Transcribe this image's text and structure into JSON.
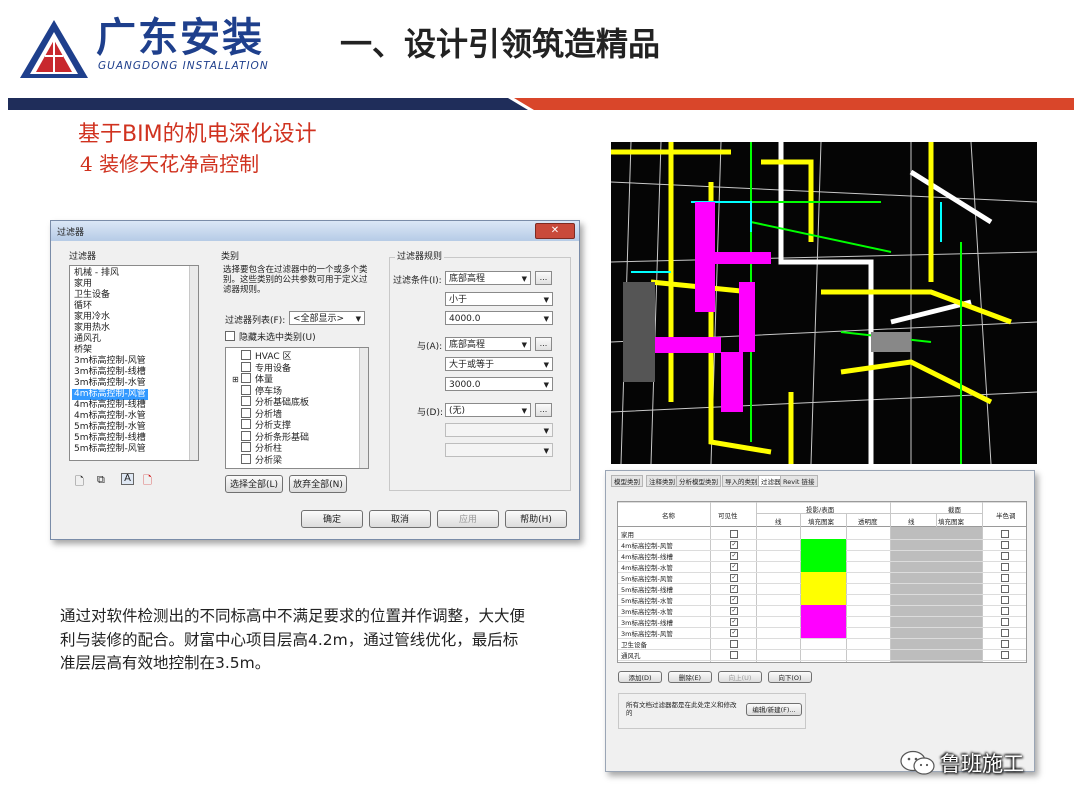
{
  "header": {
    "logo_cn": "广东安装",
    "logo_en": "GUANGDONG INSTALLATION",
    "title": "一、设计引领筑造精品",
    "colors": {
      "logo_blue": "#1e3f8c",
      "logo_red": "#c8282d",
      "bar_navy": "#1f2d5a",
      "bar_red": "#d9462a",
      "subtitle_red": "#d0321f"
    }
  },
  "subtitle": "基于BIM的机电深化设计",
  "subheading": "4   装修天花净高控制",
  "filter_dialog": {
    "title": "过滤器",
    "close_icon": "close-icon",
    "filters_label": "过滤器",
    "filters": [
      "机械 - 排风",
      "家用",
      "卫生设备",
      "循环",
      "家用冷水",
      "家用热水",
      "通风孔",
      "桥架",
      "3m标高控制-风管",
      "3m标高控制-线槽",
      "3m标高控制-水管",
      "4m标高控制-风管",
      "4m标高控制-线槽",
      "4m标高控制-水管",
      "5m标高控制-水管",
      "5m标高控制-线槽",
      "5m标高控制-风管"
    ],
    "selected_filter": "4m标高控制-风管",
    "filter_icons": [
      "new-icon",
      "duplicate-icon",
      "rename-icon",
      "delete-icon"
    ],
    "category_label": "类别",
    "category_desc": "选择要包含在过滤器中的一个或多个类别。这些类别的公共参数可用于定义过滤器规则。",
    "filter_list_label": "过滤器列表(F):",
    "filter_list_value": "<全部显示>",
    "hide_unchecked": "隐藏未选中类别(U)",
    "categories": [
      "HVAC 区",
      "专用设备",
      "体量",
      "停车场",
      "分析基础底板",
      "分析墙",
      "分析支撑",
      "分析条形基础",
      "分析柱",
      "分析梁"
    ],
    "select_all": "选择全部(L)",
    "discard_all": "放弃全部(N)",
    "rules_label": "过滤器规则",
    "rule_condition_label": "过滤条件(I):",
    "rule1_param": "底部高程",
    "rule1_op": "小于",
    "rule1_value": "4000.0",
    "and1_label": "与(A):",
    "rule2_param": "底部高程",
    "rule2_op": "大于或等于",
    "rule2_value": "3000.0",
    "and2_label": "与(D):",
    "rule3_param": "(无)",
    "ellipsis": "...",
    "ok": "确定",
    "cancel": "取消",
    "apply": "应用",
    "help": "帮助(H)"
  },
  "visibility_dialog": {
    "tabs": [
      "模型类别",
      "注释类别",
      "分析模型类别",
      "导入的类别",
      "过滤器",
      "Revit 链接"
    ],
    "active_tab": "过滤器",
    "headers": {
      "name": "名称",
      "visible": "可见性",
      "projection": "投影/表面",
      "section": "截面",
      "halftone": "半色调",
      "line": "线",
      "pattern": "填充图案",
      "transparency": "透明度"
    },
    "rows": [
      {
        "name": "家用",
        "visible": false,
        "color": ""
      },
      {
        "name": "4m标高控制-风管",
        "visible": true,
        "color": "#00ff00"
      },
      {
        "name": "4m标高控制-线槽",
        "visible": true,
        "color": "#00ff00"
      },
      {
        "name": "4m标高控制-水管",
        "visible": true,
        "color": "#00ff00"
      },
      {
        "name": "5m标高控制-风管",
        "visible": true,
        "color": "#ffff00"
      },
      {
        "name": "5m标高控制-线槽",
        "visible": true,
        "color": "#ffff00"
      },
      {
        "name": "5m标高控制-水管",
        "visible": true,
        "color": "#ffff00"
      },
      {
        "name": "3m标高控制-水管",
        "visible": true,
        "color": "#ff00ff"
      },
      {
        "name": "3m标高控制-线槽",
        "visible": true,
        "color": "#ff00ff"
      },
      {
        "name": "3m标高控制-风管",
        "visible": true,
        "color": "#ff00ff"
      },
      {
        "name": "卫生设备",
        "visible": false,
        "color": ""
      },
      {
        "name": "通风孔",
        "visible": false,
        "color": ""
      }
    ],
    "add": "添加(D)",
    "delete": "删除(E)",
    "up": "向上(U)",
    "down": "向下(O)",
    "note": "所有文档过滤器都是在此处定义和修改的",
    "edit_new": "编辑/新建(F)..."
  },
  "bim_view": {
    "colors": [
      "#00ff00",
      "#ffff00",
      "#ff00ff",
      "#ffffff",
      "#00ffff"
    ]
  },
  "body_text": "通过对软件检测出的不同标高中不满足要求的位置并作调整，大大便利与装修的配合。财富中心项目层高4.2m，通过管线优化，最后标准层层高有效地控制在3.5m。",
  "watermark": {
    "text": "鲁班施工",
    "icon": "wechat-icon"
  }
}
